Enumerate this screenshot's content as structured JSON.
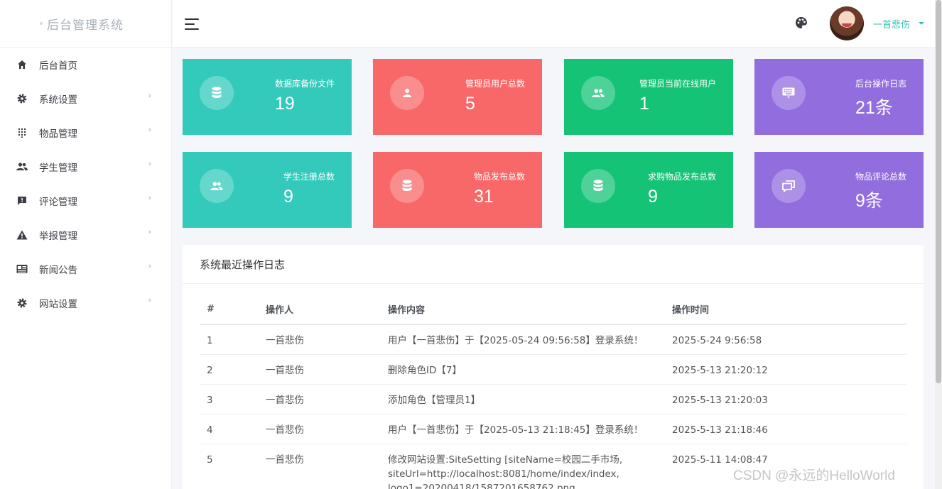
{
  "brand": {
    "title": "后台管理系统"
  },
  "sidebar": {
    "items": [
      {
        "label": "后台首页",
        "icon": "home-icon",
        "expandable": false
      },
      {
        "label": "系统设置",
        "icon": "gear-icon",
        "expandable": true
      },
      {
        "label": "物品管理",
        "icon": "grid-dots-icon",
        "expandable": true
      },
      {
        "label": "学生管理",
        "icon": "users-icon",
        "expandable": true
      },
      {
        "label": "评论管理",
        "icon": "comment-alert-icon",
        "expandable": true
      },
      {
        "label": "举报管理",
        "icon": "warning-icon",
        "expandable": true
      },
      {
        "label": "新闻公告",
        "icon": "newspaper-icon",
        "expandable": true
      },
      {
        "label": "网站设置",
        "icon": "gear-icon",
        "expandable": true
      }
    ],
    "chevron": "›"
  },
  "header": {
    "username": "一首悲伤",
    "theme_icon": "palette-icon",
    "menu_icon": "hamburger-icon"
  },
  "stats": [
    {
      "label": "数据库备份文件",
      "value": "19",
      "icon": "database-icon",
      "color": "#33cabb"
    },
    {
      "label": "管理员用户总数",
      "value": "5",
      "icon": "user-icon",
      "color": "#f96868"
    },
    {
      "label": "管理员当前在线用户",
      "value": "1",
      "icon": "users-icon",
      "color": "#15c377"
    },
    {
      "label": "后台操作日志",
      "value": "21条",
      "icon": "keyboard-icon",
      "color": "#926dde"
    },
    {
      "label": "学生注册总数",
      "value": "9",
      "icon": "users-icon",
      "color": "#33cabb"
    },
    {
      "label": "物品发布总数",
      "value": "31",
      "icon": "database-icon",
      "color": "#f96868"
    },
    {
      "label": "求购物品发布总数",
      "value": "9",
      "icon": "database-icon",
      "color": "#15c377"
    },
    {
      "label": "物品评论总数",
      "value": "9条",
      "icon": "chat-icon",
      "color": "#926dde"
    }
  ],
  "log_panel": {
    "title": "系统最近操作日志",
    "columns": [
      "#",
      "操作人",
      "操作内容",
      "操作时间"
    ],
    "rows": [
      [
        "1",
        "一首悲伤",
        "用户【一首悲伤】于【2025-05-24 09:56:58】登录系统！",
        "2025-5-24 9:56:58"
      ],
      [
        "2",
        "一首悲伤",
        "删除角色ID【7】",
        "2025-5-13 21:20:12"
      ],
      [
        "3",
        "一首悲伤",
        "添加角色【管理员1】",
        "2025-5-13 21:20:03"
      ],
      [
        "4",
        "一首悲伤",
        "用户【一首悲伤】于【2025-05-13 21:18:45】登录系统！",
        "2025-5-13 21:18:46"
      ],
      [
        "5",
        "一首悲伤",
        "修改网站设置:SiteSetting [siteName=校园二手市场,\nsiteUrl=http://localhost:8081/home/index/index,\nlogo1=20200418/1587201658762.png",
        "2025-5-11 14:08:47"
      ]
    ]
  },
  "watermark": "CSDN @永远的HelloWorld"
}
